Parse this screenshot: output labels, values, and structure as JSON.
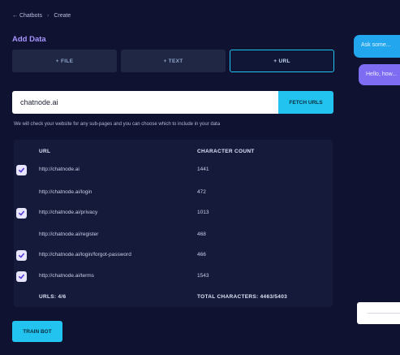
{
  "breadcrumb": {
    "back": "← Chatbots",
    "separator": "›",
    "current": "Create"
  },
  "title": "Add Data",
  "tabs": [
    {
      "label": "+ FILE",
      "active": false
    },
    {
      "label": "+ TEXT",
      "active": false
    },
    {
      "label": "+ URL",
      "active": true
    }
  ],
  "url_input": {
    "value": "chatnode.ai"
  },
  "fetch_button": "FETCH URLS",
  "hint": "We will check your website for any sub-pages and you can choose which to include in your data",
  "table": {
    "headers": {
      "url": "URL",
      "count": "CHARACTER COUNT"
    },
    "rows": [
      {
        "url": "http://chatnode.ai",
        "count": "1441",
        "checked": true
      },
      {
        "url": "http://chatnode.ai/login",
        "count": "472",
        "checked": false
      },
      {
        "url": "http://chatnode.ai/privacy",
        "count": "1013",
        "checked": true
      },
      {
        "url": "http://chatnode.ai/register",
        "count": "468",
        "checked": false
      },
      {
        "url": "http://chatnode.ai/login/forgot-password",
        "count": "466",
        "checked": true
      },
      {
        "url": "http://chatnode.ai/terms",
        "count": "1543",
        "checked": true
      }
    ],
    "footer": {
      "urls": "URLS: 4/6",
      "total": "TOTAL CHARACTERS: 4463/5403"
    }
  },
  "train_button": "TRAIN BOT",
  "chat": {
    "user_message": "Ask some...",
    "bot_message": "Hello, how..."
  },
  "colors": {
    "accent": "#22c3ee",
    "purple": "#7e6cf2",
    "background": "#0f1230"
  }
}
